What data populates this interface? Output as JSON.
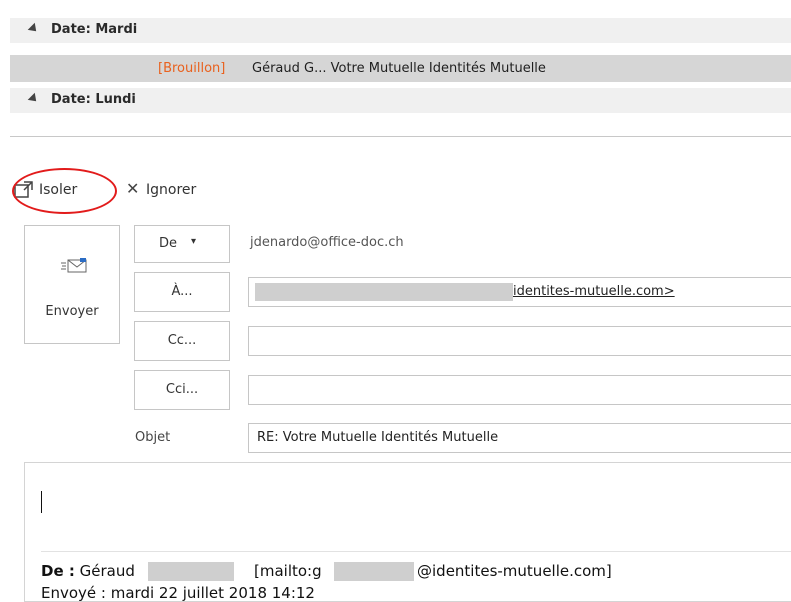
{
  "message_list": {
    "group_tuesday": "Date: Mardi",
    "group_monday": "Date: Lundi",
    "selected_row": {
      "tag": "[Brouillon]",
      "subject": "Géraud G...  Votre Mutuelle Identités Mutuelle"
    }
  },
  "commands": {
    "popout_label": "Isoler",
    "discard_label": "Ignorer"
  },
  "compose": {
    "send_label": "Envoyer",
    "from_button": "De",
    "from_value": "jdenardo@office-doc.ch",
    "to_button": "À...",
    "to_value_visible": "identites-mutuelle.com>",
    "cc_button": "Cc...",
    "cc_value": "",
    "bcc_button": "Cci...",
    "bcc_value": "",
    "subject_label": "Objet",
    "subject_value": "RE: Votre Mutuelle Identités Mutuelle"
  },
  "quoted": {
    "from_label": "De :",
    "from_name_visible": "Géraud",
    "mailto_prefix": "[mailto:g",
    "mailto_suffix": "@identites-mutuelle.com]",
    "sent_line_partial": "Envoyé : mardi 22 juillet 2018 14:12"
  }
}
